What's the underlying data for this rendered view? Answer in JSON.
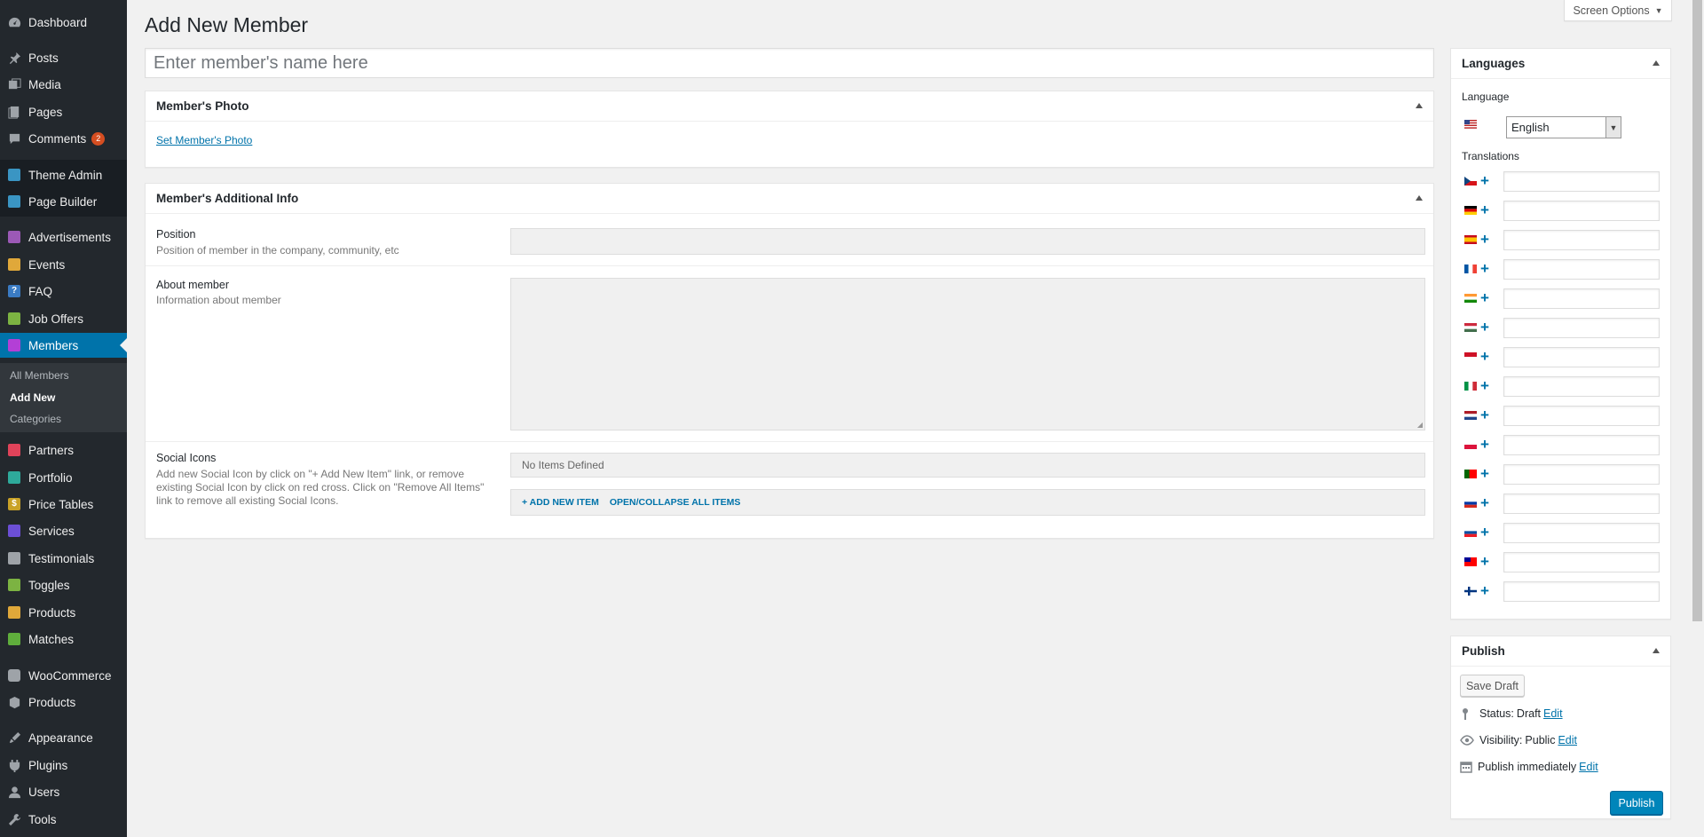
{
  "sidebar": {
    "items": [
      {
        "label": "Dashboard",
        "icon": "dashboard-icon"
      },
      {
        "label": "Posts",
        "icon": "pin-icon"
      },
      {
        "label": "Media",
        "icon": "media-icon"
      },
      {
        "label": "Pages",
        "icon": "pages-icon"
      },
      {
        "label": "Comments",
        "icon": "comments-icon",
        "badge": "2"
      },
      {
        "label": "Theme Admin",
        "icon": "theme-admin-icon"
      },
      {
        "label": "Page Builder",
        "icon": "page-builder-icon"
      },
      {
        "label": "Advertisements",
        "icon": "advertisements-icon"
      },
      {
        "label": "Events",
        "icon": "events-icon"
      },
      {
        "label": "FAQ",
        "icon": "faq-icon"
      },
      {
        "label": "Job Offers",
        "icon": "job-offers-icon"
      },
      {
        "label": "Members",
        "icon": "members-icon"
      },
      {
        "label": "Partners",
        "icon": "partners-icon"
      },
      {
        "label": "Portfolio",
        "icon": "portfolio-icon"
      },
      {
        "label": "Price Tables",
        "icon": "price-tables-icon"
      },
      {
        "label": "Services",
        "icon": "services-icon"
      },
      {
        "label": "Testimonials",
        "icon": "testimonials-icon"
      },
      {
        "label": "Toggles",
        "icon": "toggles-icon"
      },
      {
        "label": "Products",
        "icon": "products-icon"
      },
      {
        "label": "Matches",
        "icon": "matches-icon"
      },
      {
        "label": "WooCommerce",
        "icon": "woocommerce-icon"
      },
      {
        "label": "Products",
        "icon": "products-icon"
      },
      {
        "label": "Appearance",
        "icon": "appearance-icon"
      },
      {
        "label": "Plugins",
        "icon": "plugins-icon"
      },
      {
        "label": "Users",
        "icon": "users-icon"
      },
      {
        "label": "Tools",
        "icon": "tools-icon"
      }
    ],
    "submenu": [
      "All Members",
      "Add New",
      "Categories"
    ]
  },
  "header": {
    "title": "Add New Member",
    "screen_options": "Screen Options"
  },
  "title_field": {
    "placeholder": "Enter member's name here"
  },
  "photo_box": {
    "title": "Member's Photo",
    "link": "Set Member's Photo"
  },
  "info_box": {
    "title": "Member's Additional Info",
    "position_label": "Position",
    "position_desc": "Position of member in the company, community, etc",
    "about_label": "About member",
    "about_desc": "Information about member",
    "social_label": "Social Icons",
    "social_desc": "Add new Social Icon by click on \"+ Add New Item\" link, or remove existing Social Icon by click on red cross. Click on \"Remove All Items\" link to remove all existing Social Icons.",
    "no_items": "No Items Defined",
    "add_item": "+ ADD NEW ITEM",
    "toggle_items": "OPEN/COLLAPSE ALL ITEMS"
  },
  "languages_box": {
    "title": "Languages",
    "language_label": "Language",
    "selected_language": "English",
    "translations_label": "Translations",
    "translation_flags": [
      "cz",
      "de",
      "es",
      "fr",
      "in",
      "hu",
      "id",
      "it",
      "nl",
      "pl",
      "pt",
      "ru",
      "sk",
      "tw",
      "fi"
    ]
  },
  "publish_box": {
    "title": "Publish",
    "save_draft": "Save Draft",
    "status_label": "Status:",
    "status_value": "Draft",
    "visibility_label": "Visibility:",
    "visibility_value": "Public",
    "schedule_label": "Publish immediately",
    "edit": "Edit",
    "publish_button": "Publish"
  },
  "colors": {
    "sidebar_bg": "#23282d",
    "accent": "#0073aa",
    "primary_button": "#0085ba",
    "badge": "#d54e21"
  }
}
